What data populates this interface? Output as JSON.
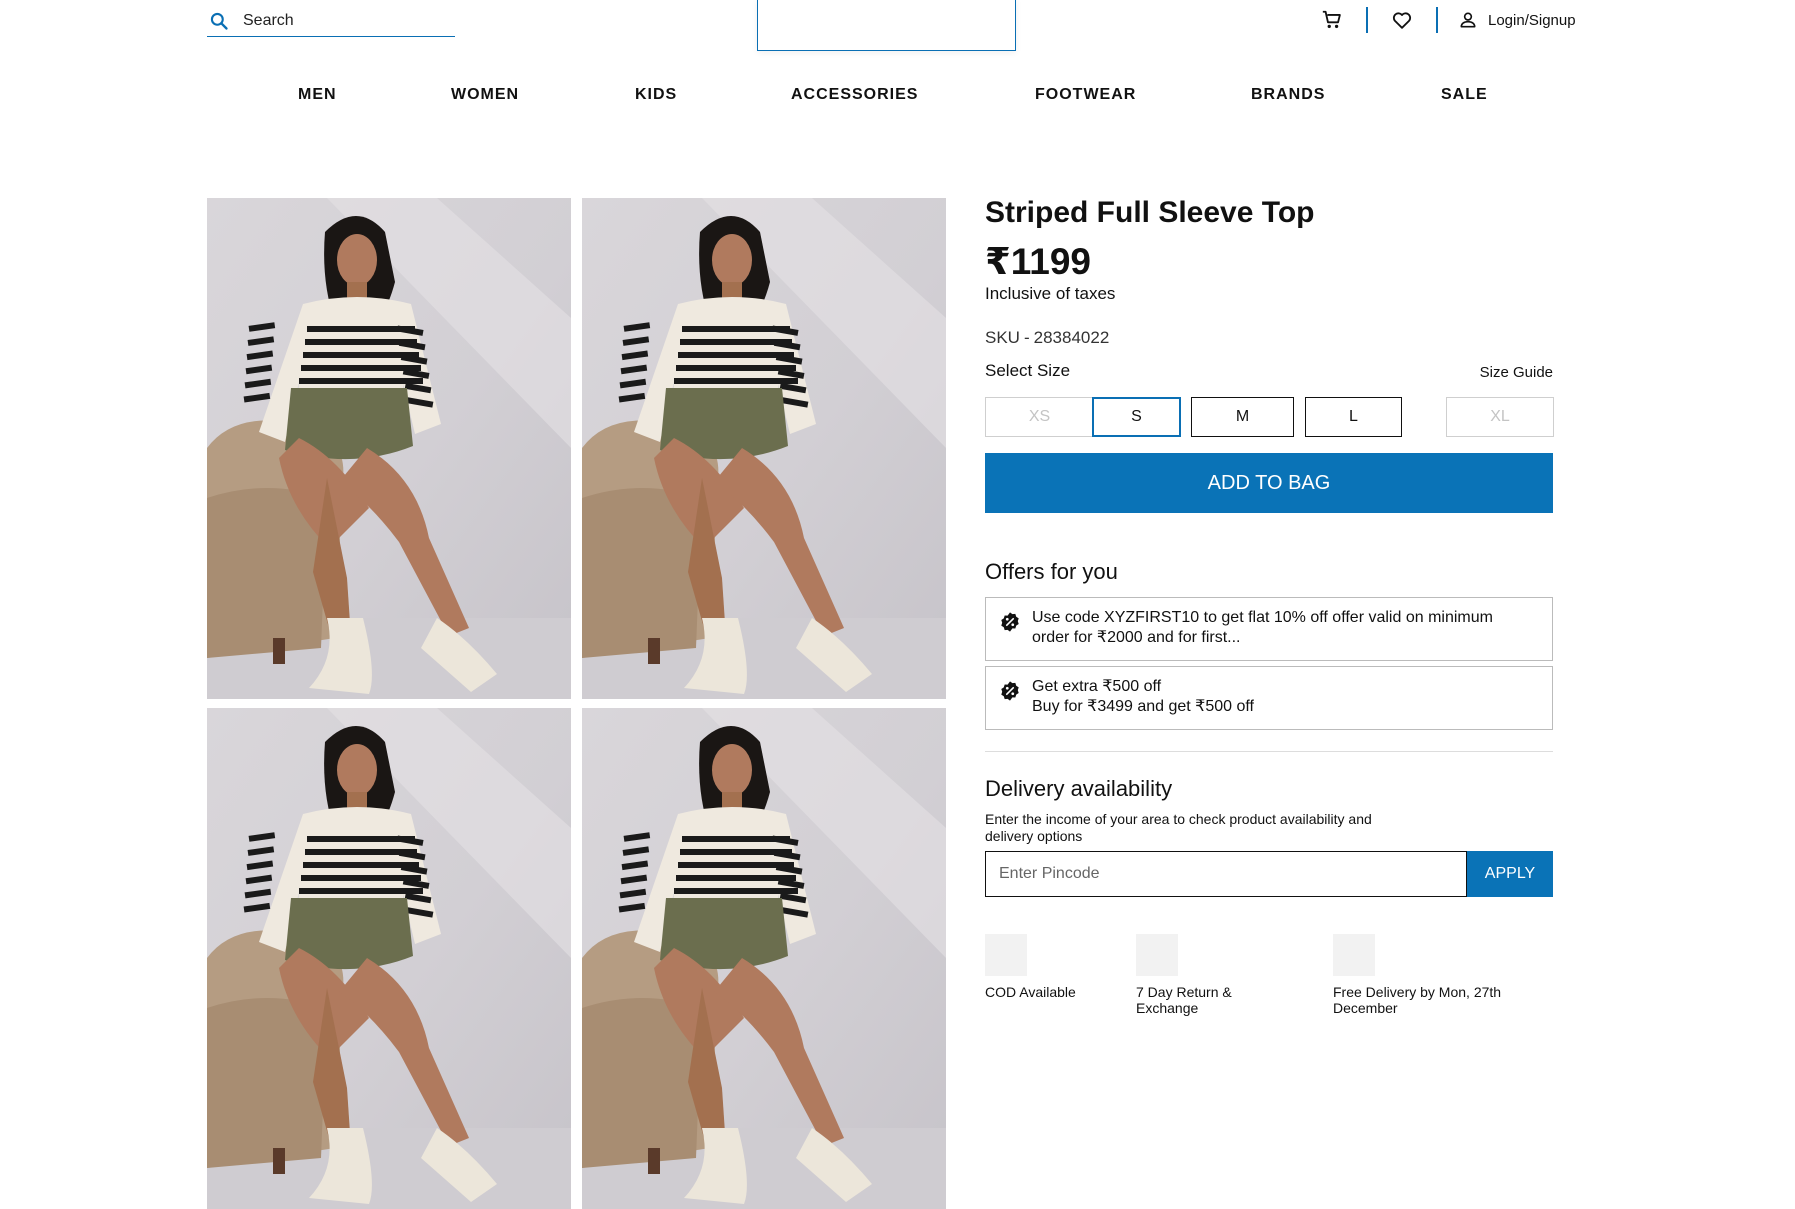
{
  "header": {
    "search_placeholder": "Search",
    "login_label": "Login/Signup",
    "accent_color": "#0a6fb4"
  },
  "nav": {
    "items": [
      "MEN",
      "WOMEN",
      "KIDS",
      "ACCESSORIES",
      "FOOTWEAR",
      "BRANDS",
      "SALE"
    ]
  },
  "product": {
    "title": "Striped Full Sleeve Top",
    "price": "₹1199",
    "tax_note": "Inclusive of taxes",
    "sku_label": "SKU",
    "sku_sep": "-",
    "sku_value": "28384022",
    "select_size_label": "Select Size",
    "size_guide_label": "Size Guide",
    "sizes": [
      {
        "label": "XS",
        "state": "disabled"
      },
      {
        "label": "S",
        "state": "selected"
      },
      {
        "label": "M",
        "state": "available"
      },
      {
        "label": "L",
        "state": "available"
      },
      {
        "label": "XL",
        "state": "disabled"
      }
    ],
    "add_to_bag_label": "ADD TO BAG"
  },
  "offers": {
    "title": "Offers for you",
    "items": [
      {
        "line1": "Use code XYZFIRST10 to get flat 10% off offer valid on minimum",
        "line2": "order for ₹2000 and for first..."
      },
      {
        "line1": "Get extra ₹500 off",
        "line2": "Buy for ₹3499 and get ₹500 off"
      }
    ]
  },
  "delivery": {
    "title": "Delivery availability",
    "description": "Enter the income of your area to check product availability and delivery options",
    "pincode_placeholder": "Enter Pincode",
    "apply_label": "APPLY"
  },
  "features": [
    {
      "label": "COD Available"
    },
    {
      "label": "7 Day Return & Exchange"
    },
    {
      "label": "Free Delivery by Mon, 27th December"
    }
  ],
  "colors": {
    "brand_blue": "#0a73b7"
  }
}
